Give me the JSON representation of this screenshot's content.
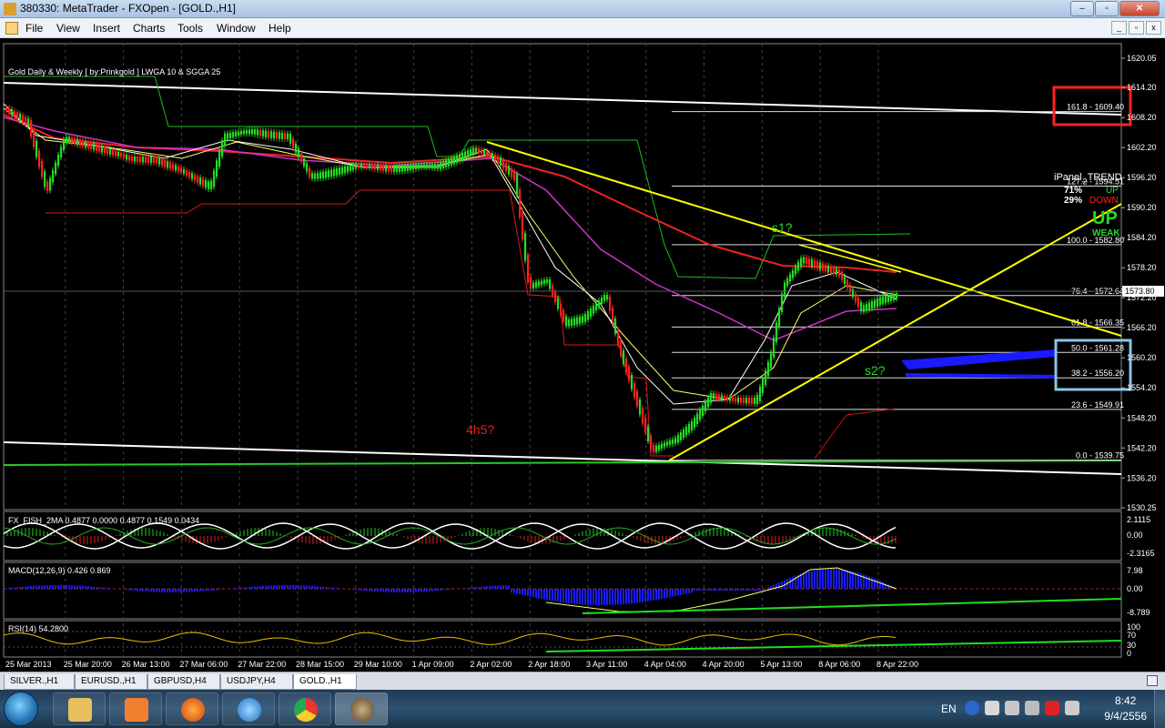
{
  "window": {
    "title": "380330: MetaTrader - FXOpen - [GOLD.,H1]",
    "buttons": [
      "–",
      "▫",
      "✕"
    ]
  },
  "menu": {
    "items": [
      "File",
      "View",
      "Insert",
      "Charts",
      "Tools",
      "Window",
      "Help"
    ],
    "mdi_buttons": [
      "_",
      "▫",
      "x"
    ]
  },
  "chart": {
    "indicator_label": "Gold Daily & Weekly [ by:Prinkgold ]  LWGA 10  &  SGGA 25",
    "price_axis": [
      "1620.05",
      "1614.20",
      "1608.20",
      "1602.20",
      "1596.20",
      "1590.20",
      "1584.20",
      "1578.20",
      "1573.80",
      "1572.20",
      "1566.20",
      "1560.20",
      "1554.20",
      "1548.20",
      "1542.20",
      "1536.20",
      "1530.25"
    ],
    "current_price": "1573.80",
    "fib_levels": [
      "161.8 - 1609.40",
      "127.2 - 1594.51",
      "100.0 - 1582.80",
      "76.4 - 1572.64",
      "61.8 - 1566.35",
      "50.0 - 1561.28",
      "38.2 - 1556.20",
      "23.6 - 1549.91",
      "0.0 - 1539.75"
    ],
    "ipanel": {
      "title": "iPanel_TREND",
      "up_pct": "71%",
      "up_label": "UP",
      "down_pct": "29%",
      "down_label": "DOWN",
      "big_label": "UP",
      "strength": "WEAK"
    },
    "annotations": {
      "s1": "s1?",
      "s2": "s2?",
      "h45": "4h5?"
    },
    "fisher": {
      "label": "FX_FISH_2MA 0.4877 0.0000 0.4877 0.1549 0.0434",
      "axis": [
        "2.1115",
        "0.00",
        "-2.3165"
      ]
    },
    "macd": {
      "label": "MACD(12,26,9) 0.426 0.869",
      "axis": [
        "7.98",
        "0.00",
        "-8.789"
      ]
    },
    "rsi": {
      "label": "RSI(14) 54.2800",
      "axis": [
        "100",
        "70",
        "30",
        "0"
      ]
    },
    "time_axis": [
      "25 Mar 2013",
      "25 Mar 20:00",
      "26 Mar 13:00",
      "27 Mar 06:00",
      "27 Mar 22:00",
      "28 Mar 15:00",
      "29 Mar 10:00",
      "1 Apr 09:00",
      "2 Apr 02:00",
      "2 Apr 18:00",
      "3 Apr 11:00",
      "4 Apr 04:00",
      "4 Apr 20:00",
      "5 Apr 13:00",
      "8 Apr 06:00",
      "8 Apr 22:00"
    ],
    "colors": {
      "candle_up": "#22dd22",
      "candle_down": "#ff2020",
      "trendline": "#ffff00",
      "bg": "#000000",
      "fib": "#ffffff"
    }
  },
  "tabs": [
    "SILVER.,H1",
    "EURUSD.,H1",
    "GBPUSD,H4",
    "USDJPY,H4",
    "GOLD.,H1"
  ],
  "active_tab": "GOLD.,H1",
  "taskbar": {
    "apps": [
      "explorer-icon",
      "media-player-icon",
      "firefox-icon",
      "internet-explorer-icon",
      "chrome-icon",
      "metatrader-icon"
    ],
    "lang": "EN",
    "time": "8:42",
    "date": "9/4/2556"
  }
}
